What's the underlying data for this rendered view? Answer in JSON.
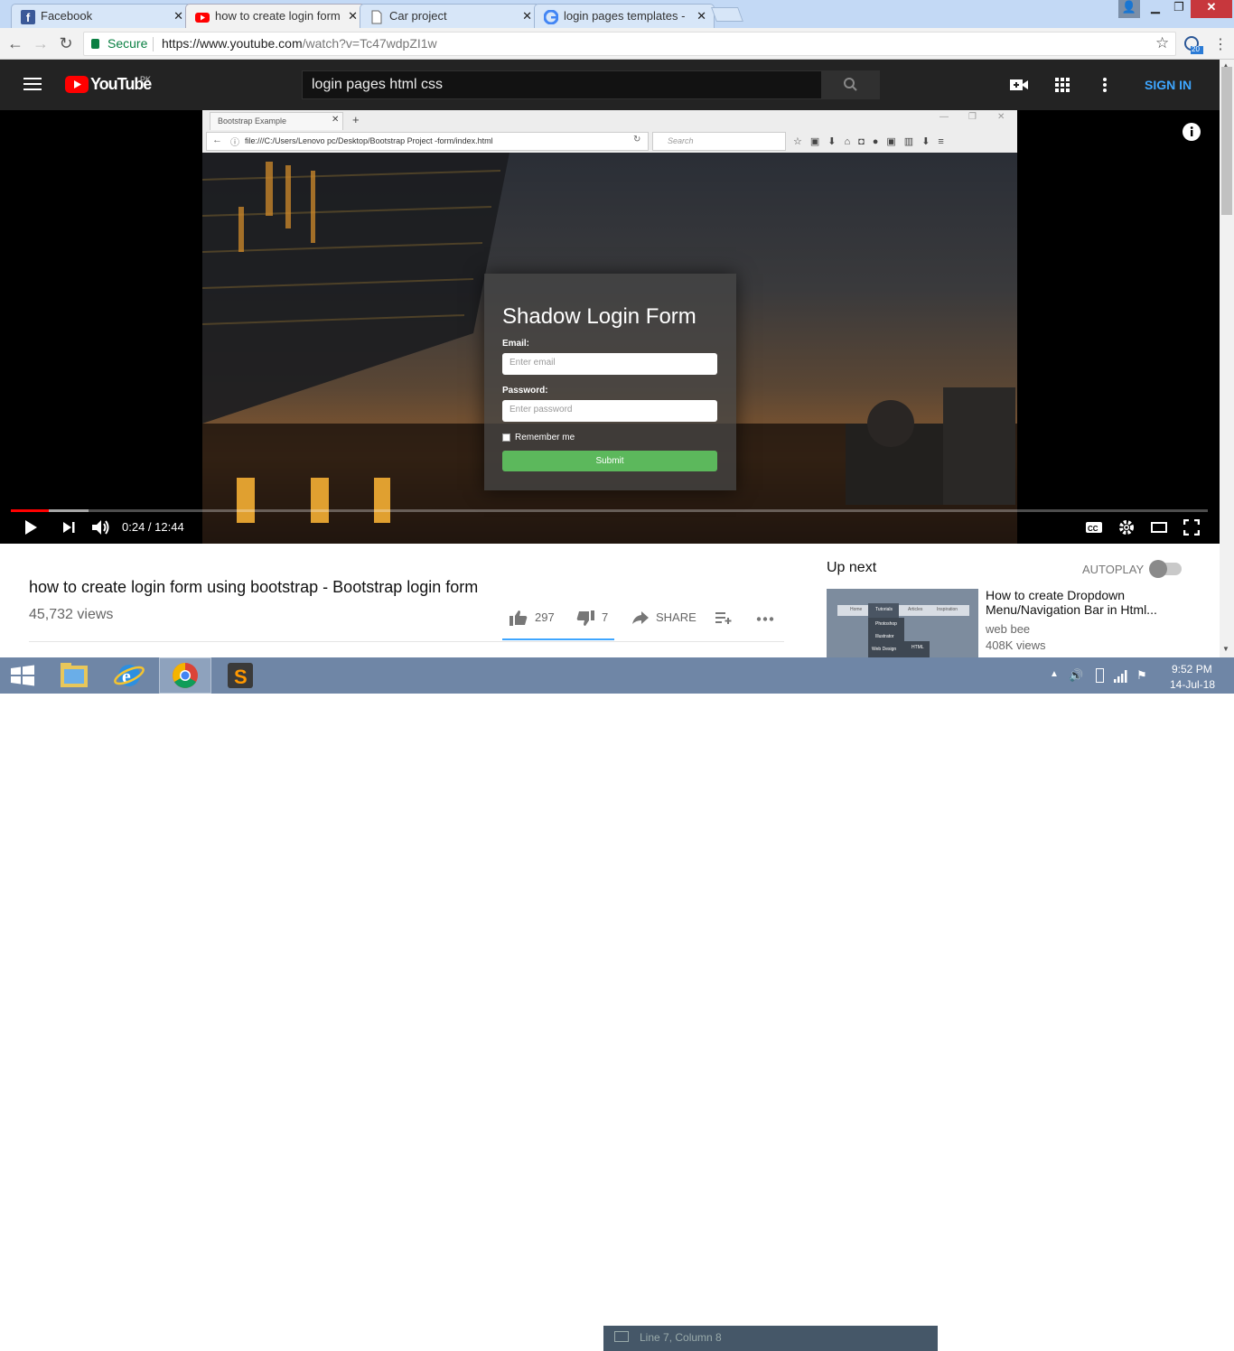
{
  "tabs": [
    {
      "title": "Facebook",
      "icon": "facebook-icon"
    },
    {
      "title": "how to create login form",
      "icon": "youtube-icon"
    },
    {
      "title": "Car project",
      "icon": "document-icon"
    },
    {
      "title": "login pages templates - G",
      "icon": "google-icon"
    }
  ],
  "address": {
    "secure_label": "Secure",
    "url_host": "https://www.youtube.com",
    "url_path": "/watch?v=Tc47wdpZI1w",
    "ext_badge": "20"
  },
  "yt": {
    "logo_text": "YouTube",
    "region": "PK",
    "search_value": "login pages html css",
    "sign_in": "SIGN IN"
  },
  "video_inner": {
    "tab_title": "Bootstrap Example",
    "file_url": "file:///C:/Users/Lenovo pc/Desktop/Bootstrap Project -form/index.html",
    "search_placeholder": "Search",
    "form_title": "Shadow Login Form",
    "email_label": "Email:",
    "email_placeholder": "Enter email",
    "password_label": "Password:",
    "password_placeholder": "Enter password",
    "remember_label": "Remember me",
    "submit_label": "Submit"
  },
  "player": {
    "time": "0:24 / 12:44",
    "played_fraction": 0.032,
    "loaded_fraction": 0.065
  },
  "video": {
    "title": "how to create login form using bootstrap - Bootstrap login form",
    "views": "45,732 views",
    "likes": "297",
    "dislikes": "7",
    "share_label": "SHARE"
  },
  "upnext": {
    "heading": "Up next",
    "autoplay_label": "AUTOPLAY",
    "item_title": "How to create Dropdown Menu/Navigation Bar in Html...",
    "channel": "web bee",
    "views": "408K views",
    "thumb_menu": [
      "Home",
      "Tutorials",
      "Articles",
      "Inspiration"
    ],
    "thumb_sub": [
      "Photoshop",
      "Illustrator",
      "Web Design"
    ],
    "thumb_sub2": "HTML"
  },
  "statusbar": {
    "text": "Line 7, Column 8"
  },
  "clock": {
    "time": "9:52 PM",
    "date": "14-Jul-18"
  },
  "colors": {
    "yt_red": "#ff0000",
    "submit_green": "#5cb85c",
    "sign_in_blue": "#3ea6ff"
  }
}
